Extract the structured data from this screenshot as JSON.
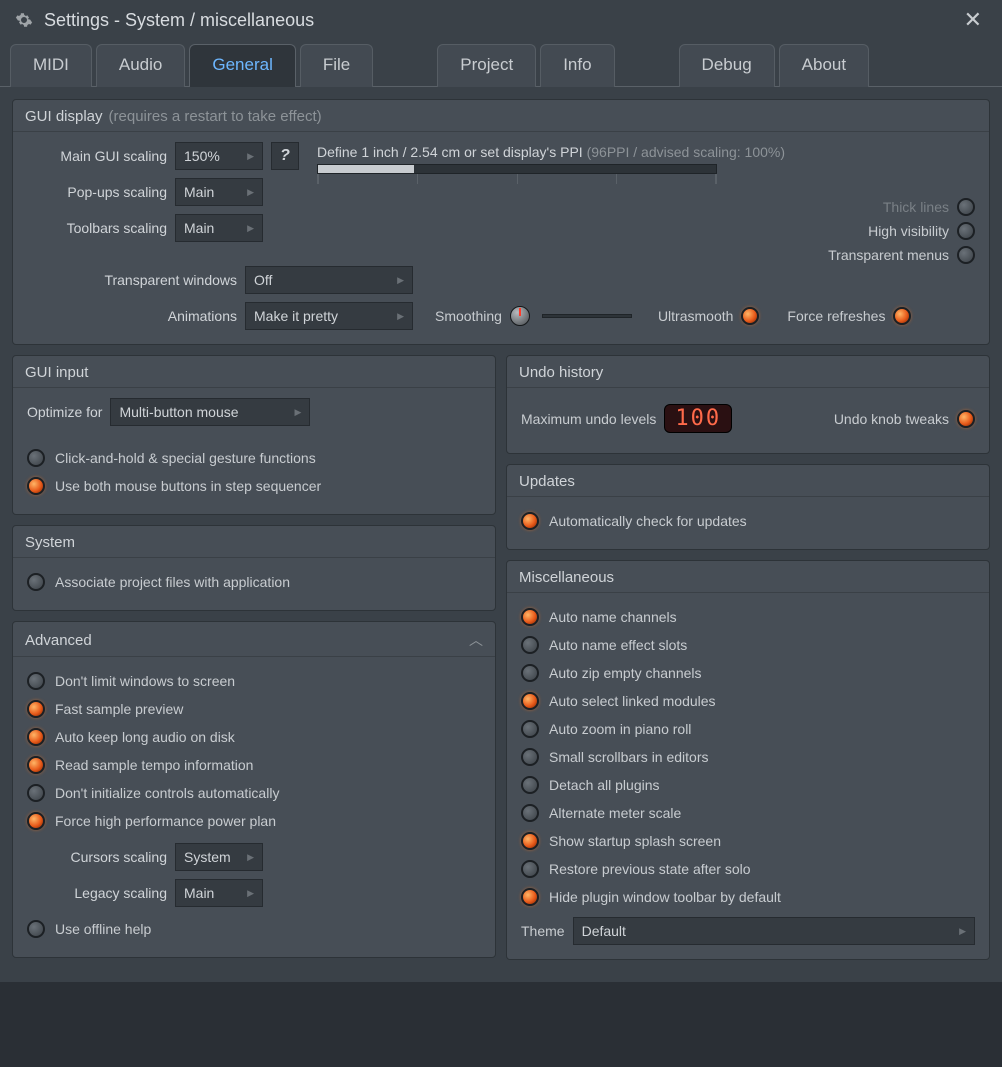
{
  "window": {
    "title": "Settings - System / miscellaneous"
  },
  "tabs": [
    "MIDI",
    "Audio",
    "General",
    "File",
    "Project",
    "Info",
    "Debug",
    "About"
  ],
  "active_tab": "General",
  "gui_display": {
    "title": "GUI display",
    "hint": "(requires a restart to take effect)",
    "main_scaling_label": "Main GUI scaling",
    "main_scaling_value": "150%",
    "popups_scaling_label": "Pop-ups scaling",
    "popups_scaling_value": "Main",
    "toolbars_scaling_label": "Toolbars scaling",
    "toolbars_scaling_value": "Main",
    "define_label": "Define 1 inch / 2.54 cm or set display's PPI",
    "define_hint": "(96PPI / advised scaling: 100%)",
    "transparent_windows_label": "Transparent windows",
    "transparent_windows_value": "Off",
    "animations_label": "Animations",
    "animations_value": "Make it pretty",
    "smoothing_label": "Smoothing",
    "ultrasmooth_label": "Ultrasmooth",
    "thick_lines_label": "Thick lines",
    "high_visibility_label": "High visibility",
    "transparent_menus_label": "Transparent menus",
    "force_refreshes_label": "Force refreshes"
  },
  "gui_input": {
    "title": "GUI input",
    "optimize_label": "Optimize for",
    "optimize_value": "Multi-button mouse",
    "click_hold_label": "Click-and-hold & special gesture functions",
    "use_both_label": "Use both mouse buttons in step sequencer"
  },
  "system": {
    "title": "System",
    "associate_label": "Associate project files with application"
  },
  "advanced": {
    "title": "Advanced",
    "dont_limit_label": "Don't limit windows to screen",
    "fast_sample_label": "Fast sample preview",
    "auto_keep_label": "Auto keep long audio on disk",
    "read_tempo_label": "Read sample tempo information",
    "dont_init_label": "Don't initialize controls automatically",
    "force_power_label": "Force high performance power plan",
    "cursors_scaling_label": "Cursors scaling",
    "cursors_scaling_value": "System",
    "legacy_scaling_label": "Legacy scaling",
    "legacy_scaling_value": "Main",
    "offline_help_label": "Use offline help"
  },
  "undo": {
    "title": "Undo history",
    "max_label": "Maximum undo levels",
    "max_value": "100",
    "knob_tweaks_label": "Undo knob tweaks"
  },
  "updates": {
    "title": "Updates",
    "auto_check_label": "Automatically check for updates"
  },
  "misc": {
    "title": "Miscellaneous",
    "auto_name_channels": "Auto name channels",
    "auto_name_effect": "Auto name effect slots",
    "auto_zip": "Auto zip empty channels",
    "auto_select_linked": "Auto select linked modules",
    "auto_zoom": "Auto zoom in piano roll",
    "small_scrollbars": "Small scrollbars in editors",
    "detach_plugins": "Detach all plugins",
    "alternate_meter": "Alternate meter scale",
    "show_splash": "Show startup splash screen",
    "restore_solo": "Restore previous state after solo",
    "hide_toolbar": "Hide plugin window toolbar by default",
    "theme_label": "Theme",
    "theme_value": "Default"
  }
}
